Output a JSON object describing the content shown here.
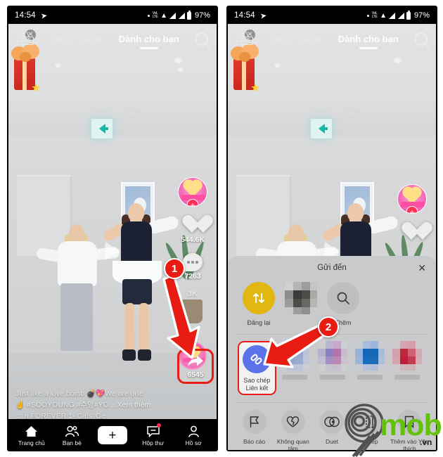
{
  "status_bar": {
    "time": "14:54",
    "airplane_icon": "paper-plane-icon",
    "volte_label": "VoLTE",
    "battery_percent": "97%"
  },
  "header": {
    "live_label": "LIVE",
    "tabs": [
      {
        "label": "Đang Follow",
        "active": false
      },
      {
        "label": "Dành cho bạn",
        "active": true
      }
    ],
    "search_icon": "search-icon"
  },
  "video": {
    "gift_close_icon": "close-icon",
    "play_icon": "play-icon",
    "caption_line1": "Just like a love bomb 💣💖We are one",
    "caption_line2": "☝ #SOOYOUNG #수영#YO...",
    "caption_more": "Xem thêm",
    "music_icon": "music-note-icon",
    "music_text": "n    FOREVER 1- Girls' Ge"
  },
  "rail": {
    "avatar_name": "avatar",
    "follow_plus": "+",
    "like_icon": "heart-icon",
    "like_count": "544.6K",
    "comment_icon": "comment-icon",
    "comment_count": "7263",
    "bookmark_count": "3K",
    "share_icon": "share-arrow-icon",
    "share_count": "6545"
  },
  "bottom_nav": [
    {
      "label": "Trang chủ",
      "icon": "home-icon"
    },
    {
      "label": "Bạn bè",
      "icon": "friends-icon"
    },
    {
      "label": "",
      "icon": "plus-icon"
    },
    {
      "label": "Hộp thư",
      "icon": "inbox-icon"
    },
    {
      "label": "Hồ sơ",
      "icon": "profile-icon"
    }
  ],
  "share_sheet": {
    "title": "Gửi đến",
    "close_icon": "close-icon",
    "row1": [
      {
        "label": "Đăng lại",
        "icon": "repost-icon"
      },
      {
        "label": "",
        "icon": "contact-avatar-blurred"
      },
      {
        "label": "Thêm",
        "icon": "search-icon"
      }
    ],
    "row2": [
      {
        "label_line1": "Sao chép",
        "label_line2": "Liên kết",
        "icon": "link-icon",
        "highlighted": true
      },
      {
        "label_line1": "",
        "label_line2": "",
        "icon": "app-icon-blurred"
      },
      {
        "label_line1": "",
        "label_line2": "",
        "icon": "app-icon-blurred"
      },
      {
        "label_line1": "",
        "label_line2": "",
        "icon": "app-icon-blurred"
      },
      {
        "label_line1": "",
        "label_line2": "",
        "icon": "app-icon-blurred"
      }
    ],
    "row3": [
      {
        "label": "Báo cáo",
        "icon": "flag-icon"
      },
      {
        "label": "Không quan tâm",
        "icon": "broken-heart-icon"
      },
      {
        "label": "Duet",
        "icon": "duet-icon"
      },
      {
        "label": "Ghép",
        "icon": "stitch-icon"
      },
      {
        "label": "Thêm vào Yêu thích",
        "icon": "bookmark-icon"
      }
    ]
  },
  "annotations": {
    "badge1": "1",
    "badge2": "2",
    "accent_color": "#e81c12"
  },
  "watermark": {
    "brand": "mobi",
    "tld": ".vn",
    "logo_icon": "nine-spiral-logo"
  }
}
